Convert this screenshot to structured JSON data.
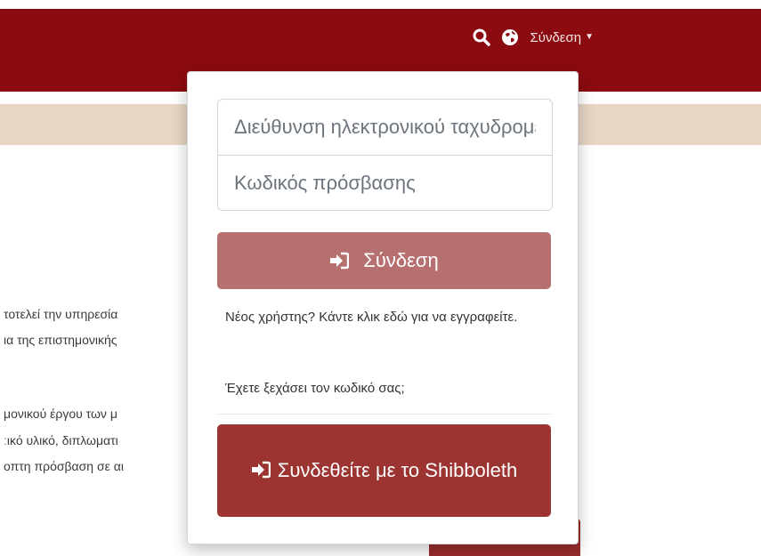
{
  "navbar": {
    "search_icon": "search-icon",
    "language_icon": "globe-icon",
    "login_label": "Σύνδεση"
  },
  "background": {
    "line_1": "τοτελεί την υπηρεσία",
    "line_2": "ια της επιστημονικής",
    "line_3": "μονικού έργου των μ",
    "line_4": "ːικό υλικό, διπλωματι",
    "line_5": "οπτη πρόσβαση σε αι"
  },
  "login_form": {
    "email_placeholder": "Διεύθυνση ηλεκτρονικού ταχυδρομείου",
    "password_placeholder": "Κωδικός πρόσβασης",
    "submit_label": "Σύνδεση",
    "submit_icon": "sign-in-icon",
    "register_text": "Νέος χρήστης? Κάντε κλικ εδώ για να εγγραφείτε.",
    "forgot_text": "Έχετε ξεχάσει τον κωδικό σας;",
    "shibboleth_label": "Συνδεθείτε με το Shibboleth",
    "shibboleth_icon": "sign-in-icon"
  },
  "colors": {
    "navbar": "#8b0b10",
    "strip": "#e7d6c3",
    "login_button": "#b5706f",
    "shibboleth_button": "#9c3531"
  }
}
